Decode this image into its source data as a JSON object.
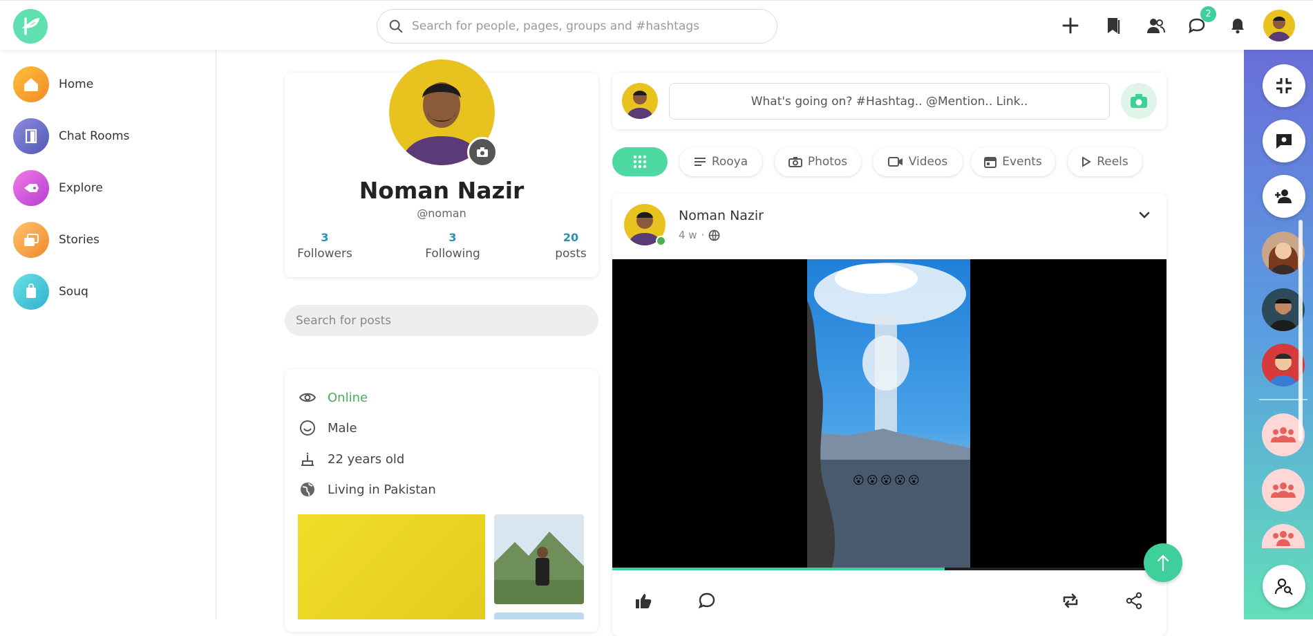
{
  "topbar": {
    "search_placeholder": "Search for people, pages, groups and #hashtags",
    "notification_badge": "2"
  },
  "sidebar": {
    "items": [
      {
        "label": "Home",
        "icon": "home-icon",
        "color": "#f7a531"
      },
      {
        "label": "Chat Rooms",
        "icon": "door-icon",
        "color": "#6b6fcf"
      },
      {
        "label": "Explore",
        "icon": "rocket-icon",
        "color": "#e45ee0"
      },
      {
        "label": "Stories",
        "icon": "images-icon",
        "color": "#f3a548"
      },
      {
        "label": "Souq",
        "icon": "bag-icon",
        "color": "#40c4d8"
      }
    ]
  },
  "profile": {
    "name": "Noman Nazir",
    "handle": "@noman",
    "stats": [
      {
        "value": "3",
        "label": "Followers"
      },
      {
        "value": "3",
        "label": "Following"
      },
      {
        "value": "20",
        "label": "posts"
      }
    ],
    "search_posts_placeholder": "Search for posts",
    "info": [
      {
        "icon": "eye-icon",
        "text": "Online",
        "color": "#4caf50"
      },
      {
        "icon": "smile-icon",
        "text": "Male",
        "color": "#444"
      },
      {
        "icon": "cake-icon",
        "text": "22 years old",
        "color": "#444"
      },
      {
        "icon": "globe-icon",
        "text": "Living in Pakistan",
        "color": "#444"
      }
    ]
  },
  "composer": {
    "placeholder": "What's going on? #Hashtag.. @Mention.. Link.."
  },
  "tabs": [
    {
      "label": "",
      "icon": "grid-icon",
      "active": true
    },
    {
      "label": "Rooya",
      "icon": "text-lines-icon"
    },
    {
      "label": "Photos",
      "icon": "camera-icon"
    },
    {
      "label": "Videos",
      "icon": "video-icon"
    },
    {
      "label": "Events",
      "icon": "calendar-icon"
    },
    {
      "label": "Reels",
      "icon": "play-icon"
    }
  ],
  "post": {
    "author": "Noman Nazir",
    "time": "4 w",
    "separator": "·",
    "video_progress": 0.6
  },
  "accent": "#3ecf9a"
}
